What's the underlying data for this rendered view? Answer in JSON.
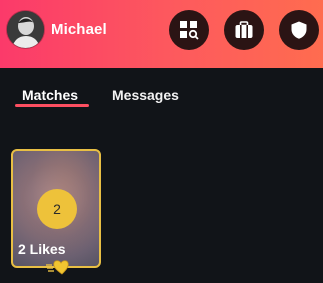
{
  "user": {
    "name": "Michael"
  },
  "header": {
    "buttons": [
      {
        "icon": "explore-grid-search-icon"
      },
      {
        "icon": "briefcase-icon"
      },
      {
        "icon": "shield-icon"
      }
    ]
  },
  "tabs": [
    {
      "label": "Matches",
      "active": true
    },
    {
      "label": "Messages",
      "active": false
    }
  ],
  "likes_card": {
    "count": "2",
    "label": "2 Likes"
  },
  "colors": {
    "header_gradient_start": "#fb3a6a",
    "header_gradient_end": "#ff6c4f",
    "background": "#111418",
    "accent_gold": "#e8bf44",
    "tab_underline": "#fd4f61"
  }
}
